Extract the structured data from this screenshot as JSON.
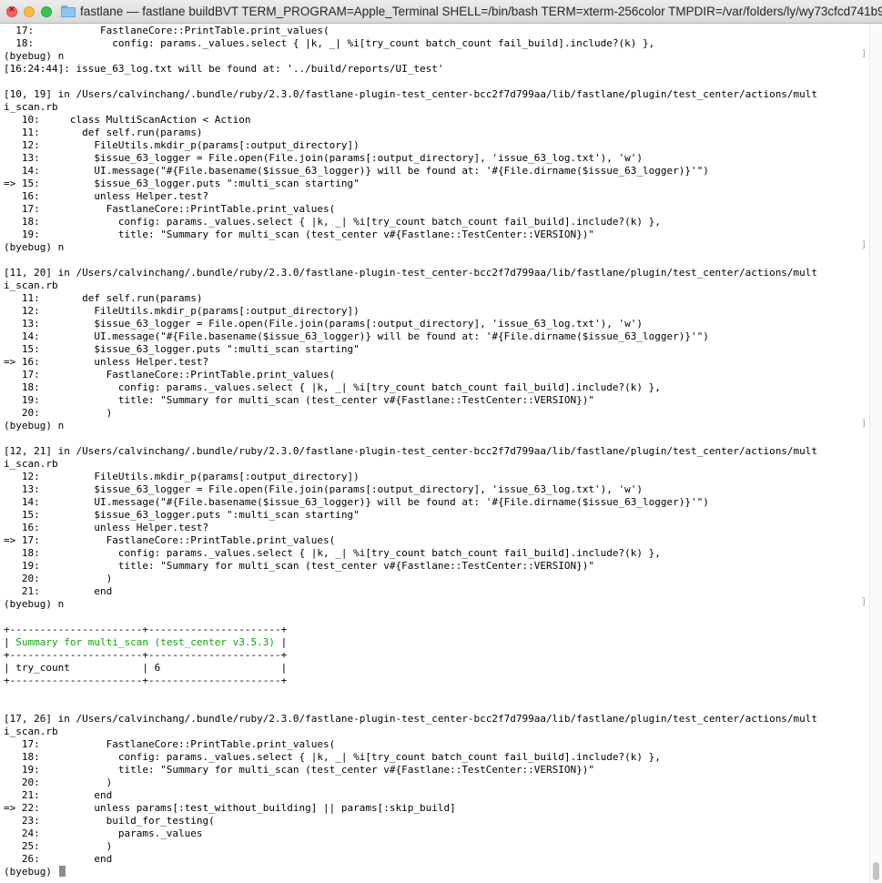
{
  "window": {
    "title": "fastlane — fastlane buildBVT TERM_PROGRAM=Apple_Terminal SHELL=/bin/bash TERM=xterm-256color TMPDIR=/var/folders/ly/wy73cfcd741b95..."
  },
  "terminal": {
    "lines": [
      "  17:           FastlaneCore::PrintTable.print_values(",
      "  18:             config: params._values.select { |k, _| %i[try_count batch_count fail_build].include?(k) },",
      "(byebug) n",
      "[16:24:44]: issue_63_log.txt will be found at: '../build/reports/UI_test'",
      "",
      "[10, 19] in /Users/calvinchang/.bundle/ruby/2.3.0/fastlane-plugin-test_center-bcc2f7d799aa/lib/fastlane/plugin/test_center/actions/mult",
      "i_scan.rb",
      "   10:     class MultiScanAction < Action",
      "   11:       def self.run(params)",
      "   12:         FileUtils.mkdir_p(params[:output_directory])",
      "   13:         $issue_63_logger = File.open(File.join(params[:output_directory], 'issue_63_log.txt'), 'w')",
      "   14:         UI.message(\"#{File.basename($issue_63_logger)} will be found at: '#{File.dirname($issue_63_logger)}'\")",
      "=> 15:         $issue_63_logger.puts \":multi_scan starting\"",
      "   16:         unless Helper.test?",
      "   17:           FastlaneCore::PrintTable.print_values(",
      "   18:             config: params._values.select { |k, _| %i[try_count batch_count fail_build].include?(k) },",
      "   19:             title: \"Summary for multi_scan (test_center v#{Fastlane::TestCenter::VERSION})\"",
      "(byebug) n",
      "",
      "[11, 20] in /Users/calvinchang/.bundle/ruby/2.3.0/fastlane-plugin-test_center-bcc2f7d799aa/lib/fastlane/plugin/test_center/actions/mult",
      "i_scan.rb",
      "   11:       def self.run(params)",
      "   12:         FileUtils.mkdir_p(params[:output_directory])",
      "   13:         $issue_63_logger = File.open(File.join(params[:output_directory], 'issue_63_log.txt'), 'w')",
      "   14:         UI.message(\"#{File.basename($issue_63_logger)} will be found at: '#{File.dirname($issue_63_logger)}'\")",
      "   15:         $issue_63_logger.puts \":multi_scan starting\"",
      "=> 16:         unless Helper.test?",
      "   17:           FastlaneCore::PrintTable.print_values(",
      "   18:             config: params._values.select { |k, _| %i[try_count batch_count fail_build].include?(k) },",
      "   19:             title: \"Summary for multi_scan (test_center v#{Fastlane::TestCenter::VERSION})\"",
      "   20:           )",
      "(byebug) n",
      "",
      "[12, 21] in /Users/calvinchang/.bundle/ruby/2.3.0/fastlane-plugin-test_center-bcc2f7d799aa/lib/fastlane/plugin/test_center/actions/mult",
      "i_scan.rb",
      "   12:         FileUtils.mkdir_p(params[:output_directory])",
      "   13:         $issue_63_logger = File.open(File.join(params[:output_directory], 'issue_63_log.txt'), 'w')",
      "   14:         UI.message(\"#{File.basename($issue_63_logger)} will be found at: '#{File.dirname($issue_63_logger)}'\")",
      "   15:         $issue_63_logger.puts \":multi_scan starting\"",
      "   16:         unless Helper.test?",
      "=> 17:           FastlaneCore::PrintTable.print_values(",
      "   18:             config: params._values.select { |k, _| %i[try_count batch_count fail_build].include?(k) },",
      "   19:             title: \"Summary for multi_scan (test_center v#{Fastlane::TestCenter::VERSION})\"",
      "   20:           )",
      "   21:         end",
      "(byebug) n",
      "",
      "+----------------------+----------------------+",
      "| Summary for multi_scan (test_center v3.5.3) |",
      "+----------------------+----------------------+",
      "| try_count            | 6                    |",
      "+----------------------+----------------------+",
      "",
      "",
      "[17, 26] in /Users/calvinchang/.bundle/ruby/2.3.0/fastlane-plugin-test_center-bcc2f7d799aa/lib/fastlane/plugin/test_center/actions/mult",
      "i_scan.rb",
      "   17:           FastlaneCore::PrintTable.print_values(",
      "   18:             config: params._values.select { |k, _| %i[try_count batch_count fail_build].include?(k) },",
      "   19:             title: \"Summary for multi_scan (test_center v#{Fastlane::TestCenter::VERSION})\"",
      "   20:           )",
      "   21:         end",
      "=> 22:         unless params[:test_without_building] || params[:skip_build]",
      "   23:           build_for_testing(",
      "   24:             params._values",
      "   25:           )",
      "   26:         end",
      "(byebug) "
    ],
    "highlight_color": "#13a10e",
    "cursor_color": "#8c8c8c"
  }
}
